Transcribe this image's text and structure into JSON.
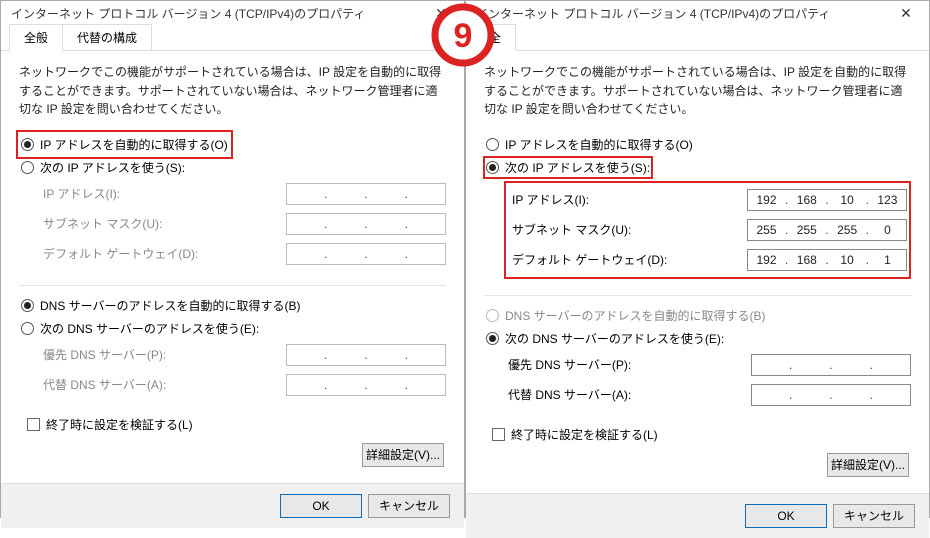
{
  "marker": "9",
  "left": {
    "title": "インターネット プロトコル バージョン 4 (TCP/IPv4)のプロパティ",
    "tabs": {
      "general": "全般",
      "alt": "代替の構成"
    },
    "desc": "ネットワークでこの機能がサポートされている場合は、IP 設定を自動的に取得することができます。サポートされていない場合は、ネットワーク管理者に適切な IP 設定を問い合わせてください。",
    "ip_auto": "IP アドレスを自動的に取得する(O)",
    "ip_manual": "次の IP アドレスを使う(S):",
    "ip_addr": "IP アドレス(I):",
    "subnet": "サブネット マスク(U):",
    "gateway": "デフォルト ゲートウェイ(D):",
    "dns_auto": "DNS サーバーのアドレスを自動的に取得する(B)",
    "dns_manual": "次の DNS サーバーのアドレスを使う(E):",
    "dns_pref": "優先 DNS サーバー(P):",
    "dns_alt": "代替 DNS サーバー(A):",
    "validate": "終了時に設定を検証する(L)",
    "advanced": "詳細設定(V)...",
    "ok": "OK",
    "cancel": "キャンセル"
  },
  "right": {
    "title": "インターネット プロトコル バージョン 4 (TCP/IPv4)のプロパティ",
    "tabs": {
      "general": "全"
    },
    "desc": "ネットワークでこの機能がサポートされている場合は、IP 設定を自動的に取得することができます。サポートされていない場合は、ネットワーク管理者に適切な IP 設定を問い合わせてください。",
    "ip_auto": "IP アドレスを自動的に取得する(O)",
    "ip_manual": "次の IP アドレスを使う(S):",
    "ip_addr": "IP アドレス(I):",
    "subnet": "サブネット マスク(U):",
    "gateway": "デフォルト ゲートウェイ(D):",
    "dns_auto": "DNS サーバーのアドレスを自動的に取得する(B)",
    "dns_manual": "次の DNS サーバーのアドレスを使う(E):",
    "dns_pref": "優先 DNS サーバー(P):",
    "dns_alt": "代替 DNS サーバー(A):",
    "validate": "終了時に設定を検証する(L)",
    "advanced": "詳細設定(V)...",
    "ok": "OK",
    "cancel": "キャンセル",
    "values": {
      "ip": [
        "192",
        "168",
        "10",
        "123"
      ],
      "mask": [
        "255",
        "255",
        "255",
        "0"
      ],
      "gw": [
        "192",
        "168",
        "10",
        "1"
      ]
    }
  }
}
